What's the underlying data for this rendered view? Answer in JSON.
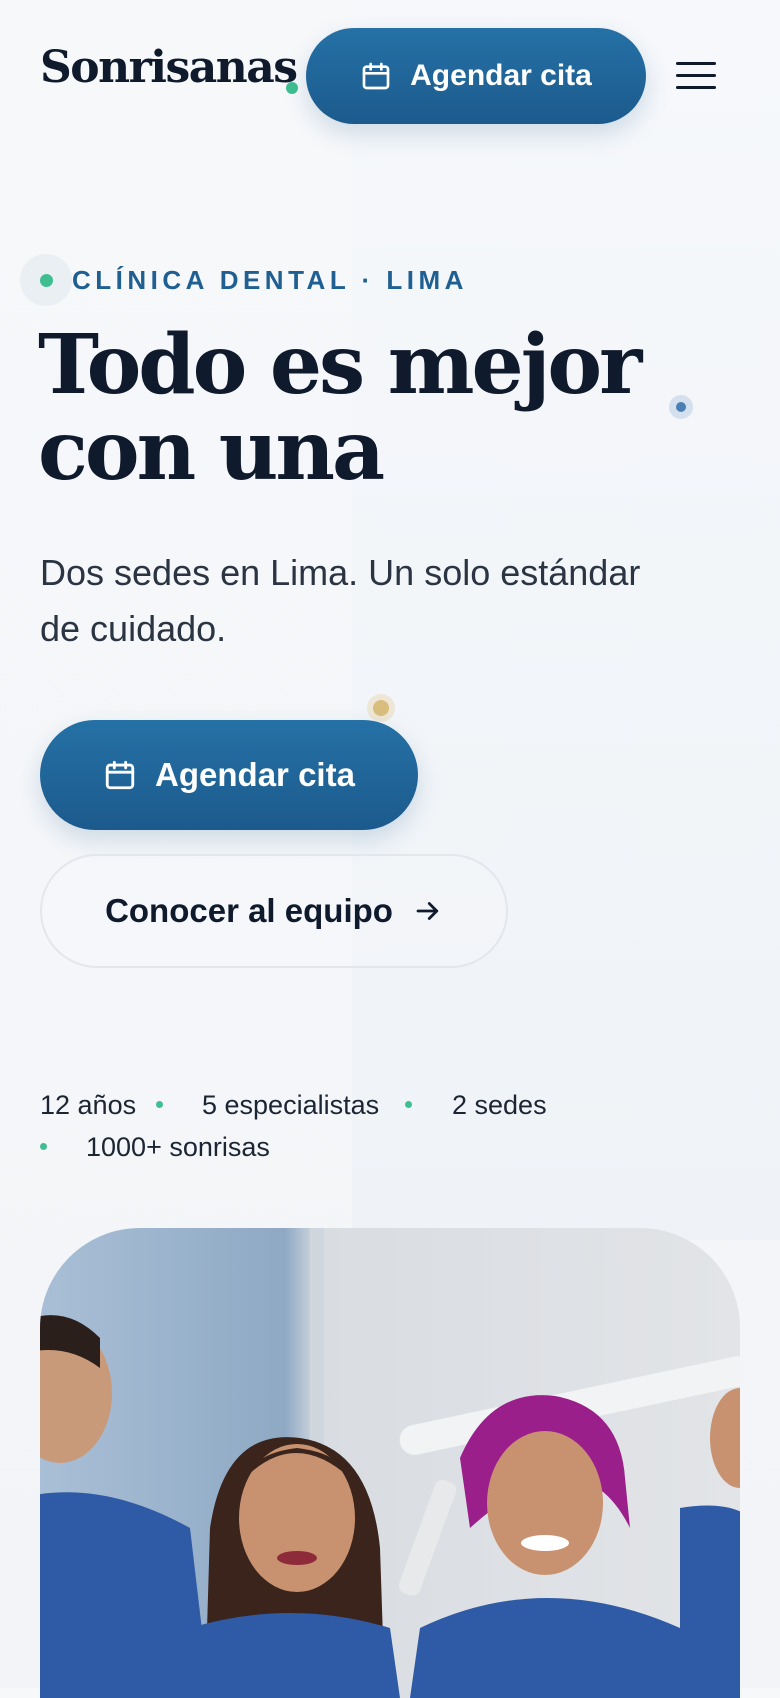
{
  "header": {
    "brand": "Sonrisanas",
    "cta_label": "Agendar cita"
  },
  "hero": {
    "eyebrow": "CLÍNICA DENTAL · LIMA",
    "headline": "Todo es mejor con una",
    "lead": "Dos sedes en Lima. Un solo estándar de cuidado.",
    "primary_cta": "Agendar cita",
    "secondary_cta": "Conocer al equipo"
  },
  "stats": [
    "12 años",
    "5 especialistas",
    "2 sedes",
    "1000+ sonrisas"
  ],
  "icons": {
    "calendar": "calendar-icon",
    "menu": "hamburger-menu-icon",
    "arrow": "arrow-right-icon"
  },
  "colors": {
    "brand_blue": "#1f5f92",
    "accent_green": "#3fbf91",
    "ink": "#0f1b2d"
  }
}
